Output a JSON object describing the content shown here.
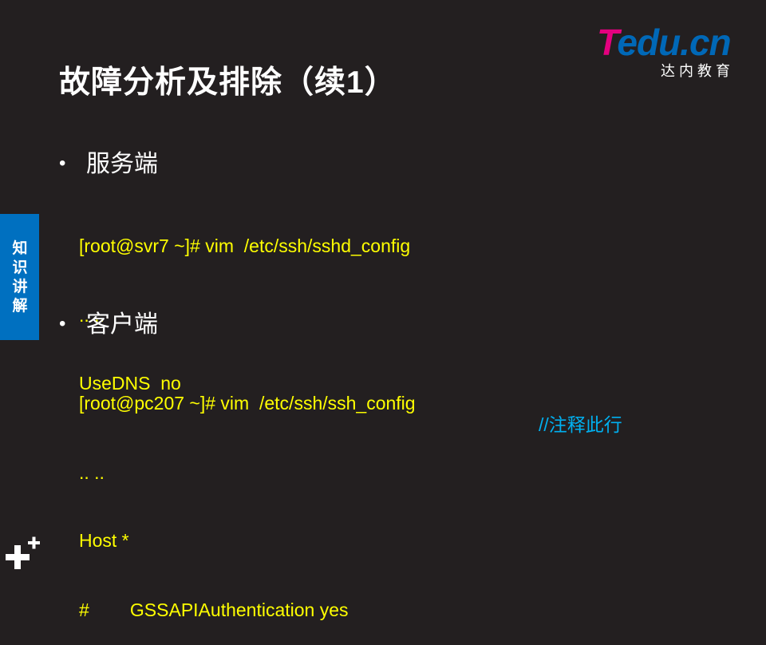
{
  "slide": {
    "title": "故障分析及排除（续1）",
    "logo": {
      "brand_first": "T",
      "brand_rest": "edu.cn",
      "subtitle": "达内教育"
    },
    "side_tab": "知识讲解",
    "sections": [
      {
        "bullet": "•",
        "heading": "服务端",
        "code": [
          "[root@svr7 ~]# vim  /etc/ssh/sshd_config",
          ".. ..",
          "UseDNS  no"
        ]
      },
      {
        "bullet": "•",
        "heading": "客户端",
        "code": [
          "[root@pc207 ~]# vim  /etc/ssh/ssh_config",
          ".. ..",
          "Host *",
          "#        GSSAPIAuthentication yes"
        ],
        "comment": "//注释此行"
      }
    ]
  },
  "colors": {
    "background": "#231f20",
    "code": "#ffff00",
    "comment": "#00b0f0",
    "side_tab": "#0070c0",
    "logo_pink": "#e4007f",
    "logo_blue": "#0068b7"
  },
  "icons": {
    "corner": "plus-icon"
  }
}
